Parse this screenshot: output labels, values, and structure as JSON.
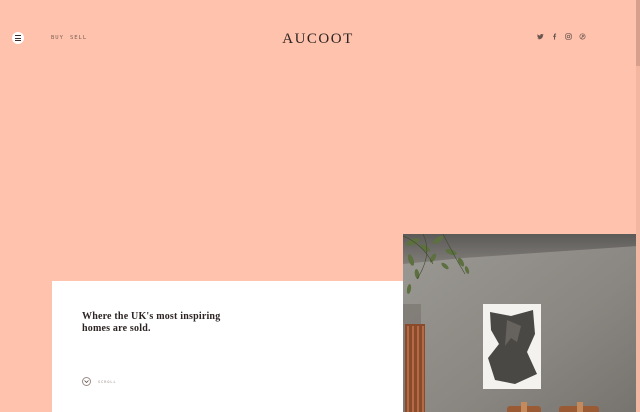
{
  "header": {
    "menu_icon": "hamburger-menu-icon",
    "nav": [
      {
        "label": "BUY"
      },
      {
        "label": "SELL"
      }
    ],
    "logo": "AUCOOT",
    "social_icons": [
      "twitter-icon",
      "facebook-icon",
      "instagram-icon",
      "pinterest-icon"
    ]
  },
  "hero": {
    "headline": "Where the UK's most inspiring homes are sold.",
    "scroll_label": "SCROLL",
    "scroll_icon": "chevron-down-icon"
  },
  "colors": {
    "background": "#ffc2ac",
    "card": "#ffffff",
    "text": "#2c2422"
  }
}
